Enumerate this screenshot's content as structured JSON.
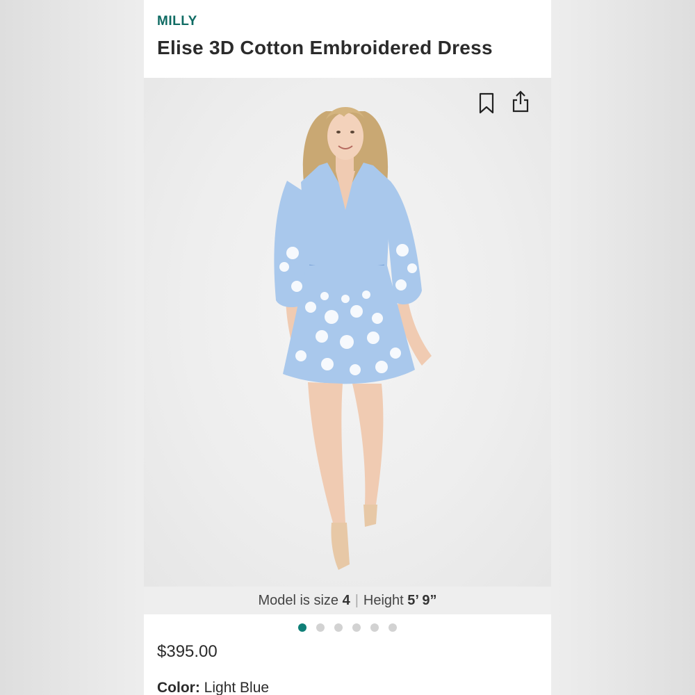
{
  "header": {
    "brand": "MILLY",
    "title": "Elise 3D Cotton Embroidered Dress"
  },
  "hero": {
    "image_alt": "Model wearing light blue embroidered dress",
    "icons": [
      "bookmark-icon",
      "share-icon"
    ]
  },
  "model_info": {
    "size_label": "Model is size ",
    "size_value": "4",
    "height_label": "Height ",
    "height_value": "5’ 9”"
  },
  "carousel": {
    "total": 6,
    "active_index": 0
  },
  "price": "$395.00",
  "color": {
    "label": "Color:",
    "value": "Light Blue"
  },
  "colors": {
    "brand": "#0f6b63",
    "dot_active": "#0f7f77",
    "dot_inactive": "#d2d2d2",
    "dress": "#a9c8ec"
  }
}
